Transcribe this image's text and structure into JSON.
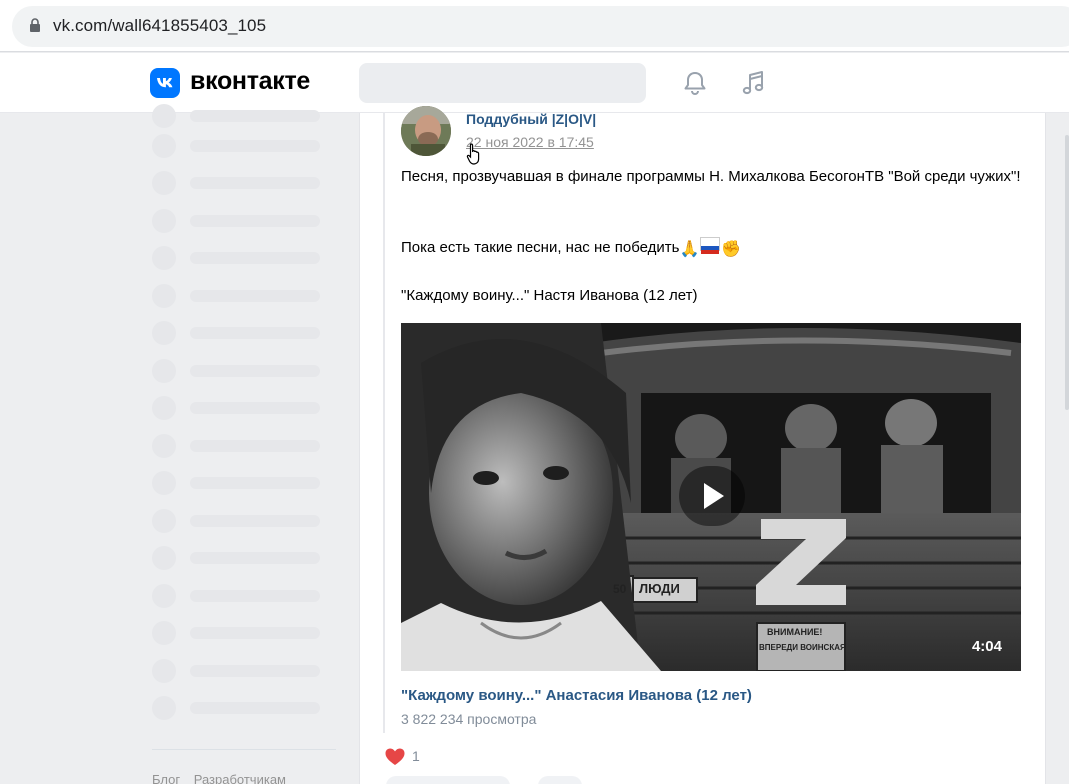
{
  "browser": {
    "url": "vk.com/wall641855403_105"
  },
  "header": {
    "logo_text": "вконтакте",
    "brand_color": "#0077ff"
  },
  "post": {
    "author": "Поддубный |Z|O|V|",
    "date": "22 ноя 2022 в 17:45",
    "text_line1": "Песня, прозвучавшая в финале программы Н. Михалкова БесогонТВ \"Вой среди чужих\"!",
    "text_line2": "Пока есть такие песни, нас не победить",
    "text_line2_emojis": [
      "pray-emoji",
      "russian-flag-emoji",
      "raised-fist-emoji"
    ],
    "text_line3": "\"Каждому воину...\" Настя Иванова (12 лет)",
    "video": {
      "duration": "4:04",
      "truck_sign_left": "ЛЮДИ",
      "truck_sign_number": "50",
      "truck_warning_line1": "ВНИМАНИЕ!",
      "truck_warning_line2": "ВПЕРЕДИ ВОИНСКАЯ",
      "title": "\"Каждому воину...\" Анастасия Иванова (12 лет)",
      "views": "3 822 234 просмотра"
    },
    "likes": "1",
    "link_color": "#2a5885",
    "like_color": "#e64646"
  },
  "sidebar": {
    "footer_links": [
      "Блог",
      "Разработчикам"
    ]
  }
}
